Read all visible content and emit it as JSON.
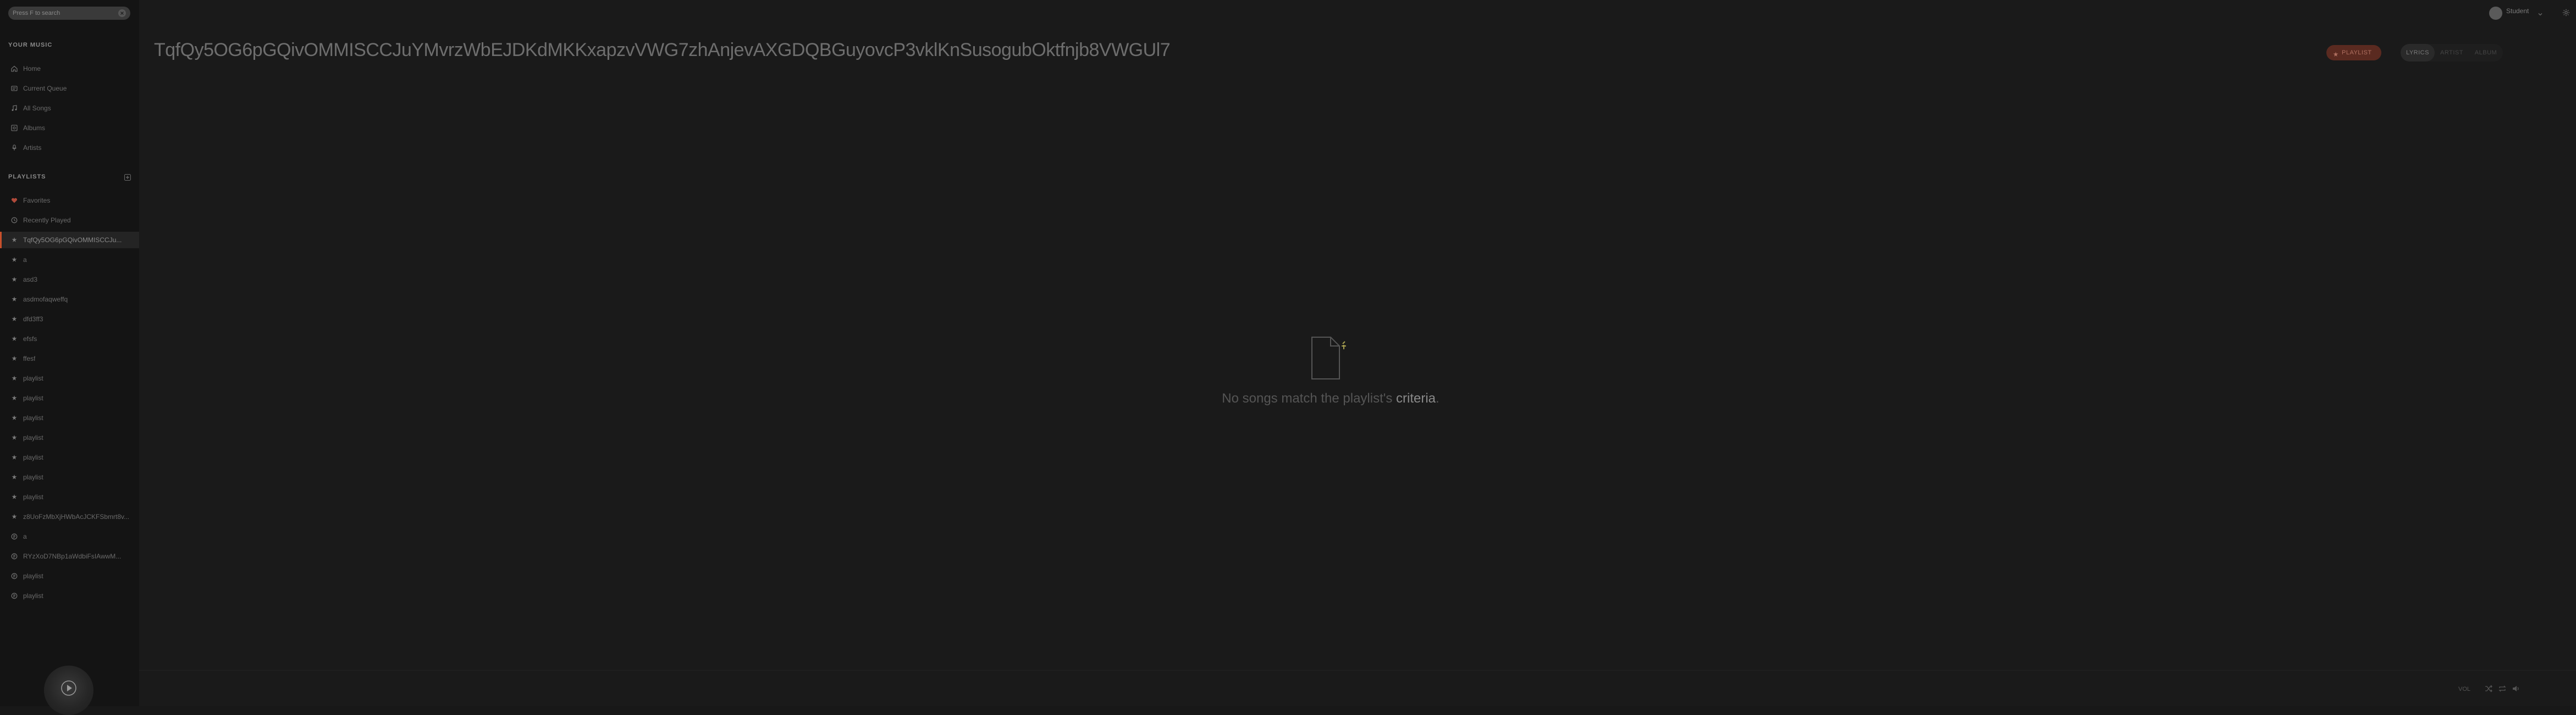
{
  "window": {
    "playback_progress": 0.472
  },
  "search": {
    "placeholder": "Press F to search"
  },
  "sidebar": {
    "your_music_title": "YOUR MUSIC",
    "nav": [
      {
        "label": "Home",
        "icon": "home-icon"
      },
      {
        "label": "Current Queue",
        "icon": "queue-icon"
      },
      {
        "label": "All Songs",
        "icon": "music-note-icon"
      },
      {
        "label": "Albums",
        "icon": "album-icon"
      },
      {
        "label": "Artists",
        "icon": "microphone-icon"
      }
    ],
    "playlists_title": "PLAYLISTS",
    "playlists": [
      {
        "label": "Favorites",
        "icon": "heart-icon"
      },
      {
        "label": "Recently Played",
        "icon": "clock-icon"
      },
      {
        "label": "TqfQy5OG6pGQivOMMISCCJu...",
        "icon": "smart-playlist-icon",
        "active": true
      },
      {
        "label": "a",
        "icon": "smart-playlist-icon"
      },
      {
        "label": "asd3",
        "icon": "smart-playlist-icon"
      },
      {
        "label": "asdmofaqweffq",
        "icon": "smart-playlist-icon"
      },
      {
        "label": "dfd3ff3",
        "icon": "smart-playlist-icon"
      },
      {
        "label": "efsfs",
        "icon": "smart-playlist-icon"
      },
      {
        "label": "ffesf",
        "icon": "smart-playlist-icon"
      },
      {
        "label": "playlist",
        "icon": "smart-playlist-icon"
      },
      {
        "label": "playlist",
        "icon": "smart-playlist-icon"
      },
      {
        "label": "playlist",
        "icon": "smart-playlist-icon"
      },
      {
        "label": "playlist",
        "icon": "smart-playlist-icon"
      },
      {
        "label": "playlist",
        "icon": "smart-playlist-icon"
      },
      {
        "label": "playlist",
        "icon": "smart-playlist-icon"
      },
      {
        "label": "playlist",
        "icon": "smart-playlist-icon"
      },
      {
        "label": "z8UoFzMbXjHWbAcJCKFSbmrt8v...",
        "icon": "smart-playlist-icon"
      },
      {
        "label": "a",
        "icon": "playlist-icon"
      },
      {
        "label": "RYzXoD7NBp1aWdbiFsIAwwM...",
        "icon": "playlist-icon"
      },
      {
        "label": "playlist",
        "icon": "playlist-icon"
      },
      {
        "label": "playlist",
        "icon": "playlist-icon"
      }
    ]
  },
  "header": {
    "title": "TqfQy5OG6pGQivOMMISCCJuYMvrzWbEJDKdMKKxapzvVWG7zhAnjevAXGDQBGuyovcP3vklKnSusogubOktfnjb8VWGUl7",
    "playlist_button": "PLAYLIST",
    "tabs": [
      "LYRICS",
      "ARTIST",
      "ALBUM"
    ],
    "active_tab": 0
  },
  "user": {
    "name": "Student"
  },
  "empty_state": {
    "text_prefix": "No songs match the playlist's ",
    "text_emphasis": "criteria",
    "text_suffix": "."
  },
  "footer": {
    "volume_label": "VOL"
  },
  "colors": {
    "accent": "#c8502c",
    "background": "#181818"
  }
}
